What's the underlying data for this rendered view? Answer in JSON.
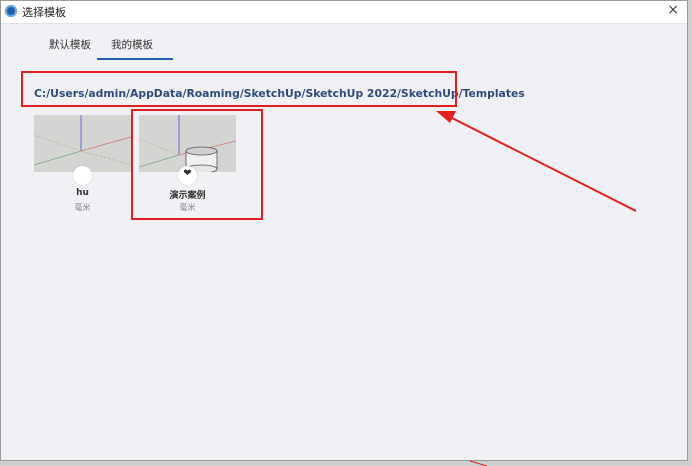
{
  "window": {
    "title": "选择模板",
    "close_glyph": "×",
    "icon": "sketchup-app-icon"
  },
  "tabs": [
    {
      "label": "默认模板",
      "active": false
    },
    {
      "label": "我的模板",
      "active": true
    }
  ],
  "path": "C:/Users/admin/AppData/Roaming/SketchUp/SketchUp 2022/SketchUp/Templates",
  "templates": [
    {
      "name": "hu",
      "unit": "毫米",
      "badge": "none"
    },
    {
      "name": "演示案例",
      "unit": "毫米",
      "badge": "heart-icon",
      "badge_glyph": "❤"
    }
  ],
  "colors": {
    "accent": "#1f5fa8",
    "annotation_red": "#e02020",
    "path_text": "#2d4c7c"
  }
}
